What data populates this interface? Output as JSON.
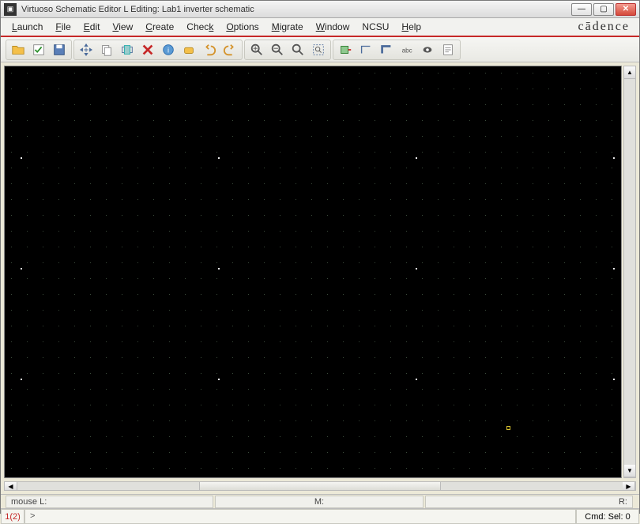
{
  "window": {
    "title": "Virtuoso Schematic Editor L Editing: Lab1 inverter schematic"
  },
  "brand": "cādence",
  "menus": [
    {
      "label": "Launch",
      "u": "L"
    },
    {
      "label": "File",
      "u": "F"
    },
    {
      "label": "Edit",
      "u": "E"
    },
    {
      "label": "View",
      "u": "V"
    },
    {
      "label": "Create",
      "u": "C"
    },
    {
      "label": "Check",
      "u": "k"
    },
    {
      "label": "Options",
      "u": "O"
    },
    {
      "label": "Migrate",
      "u": "M"
    },
    {
      "label": "Window",
      "u": "W"
    },
    {
      "label": "NCSU",
      "u": ""
    },
    {
      "label": "Help",
      "u": "H"
    }
  ],
  "toolbar_groups": [
    [
      "open",
      "check-save",
      "save"
    ],
    [
      "move",
      "copy",
      "stretch",
      "delete",
      "property",
      "rotate",
      "undo",
      "redo"
    ],
    [
      "zoom-in",
      "zoom-out",
      "zoom-fit",
      "zoom-area"
    ],
    [
      "instance",
      "wire-narrow",
      "wire-wide",
      "label",
      "pin",
      "note"
    ]
  ],
  "status": {
    "mouseL": "mouse L:",
    "mouseM": "M:",
    "mouseR": "R:"
  },
  "command": {
    "line_num": "1(2)",
    "prompt": ">",
    "sel": "Cmd: Sel: 0"
  }
}
